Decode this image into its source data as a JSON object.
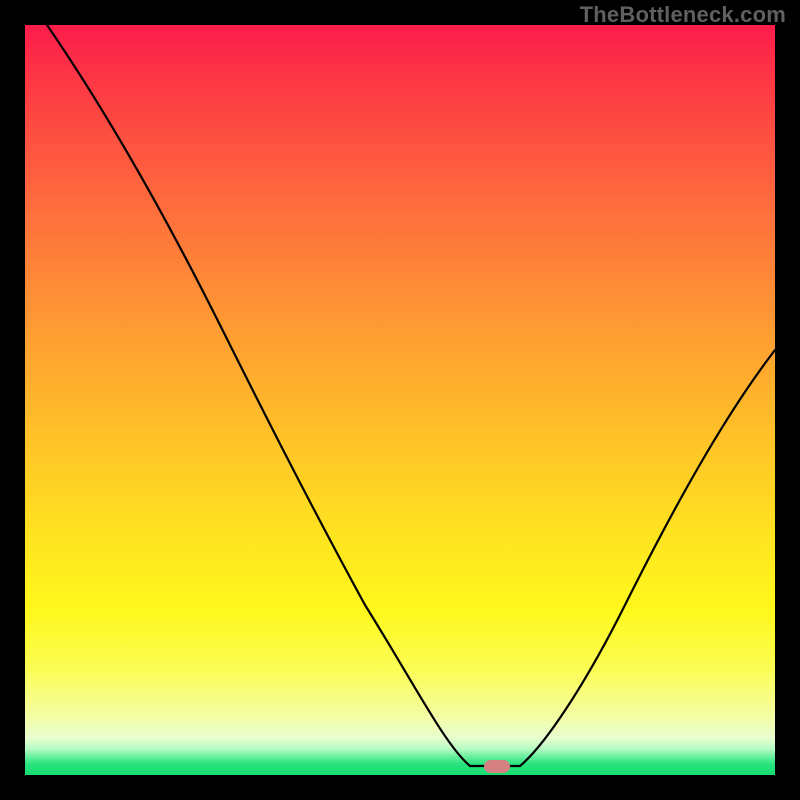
{
  "watermark": "TheBottleneck.com",
  "chart_data": {
    "type": "line",
    "title": "",
    "xlabel": "",
    "ylabel": "",
    "xlim": [
      0,
      100
    ],
    "ylim": [
      0,
      100
    ],
    "grid": false,
    "legend": false,
    "colors": {
      "top": "#fc1d4b",
      "mid_high": "#ff9a33",
      "mid": "#ffe320",
      "low": "#f4fda0",
      "bottom": "#12dd70",
      "curve": "#000000",
      "marker": "#d68083"
    },
    "series": [
      {
        "name": "bottleneck-curve",
        "x": [
          3,
          10,
          20,
          28,
          35,
          42,
          48,
          54,
          58,
          60,
          61.5,
          64,
          66,
          72,
          80,
          88,
          95,
          100
        ],
        "y": [
          100,
          88,
          70,
          55,
          42,
          30,
          20,
          10,
          4,
          1.5,
          0.5,
          0.5,
          1,
          6,
          18,
          34,
          48,
          57
        ]
      }
    ],
    "marker": {
      "x": 63,
      "y": 0.5,
      "shape": "rounded-rect"
    }
  }
}
